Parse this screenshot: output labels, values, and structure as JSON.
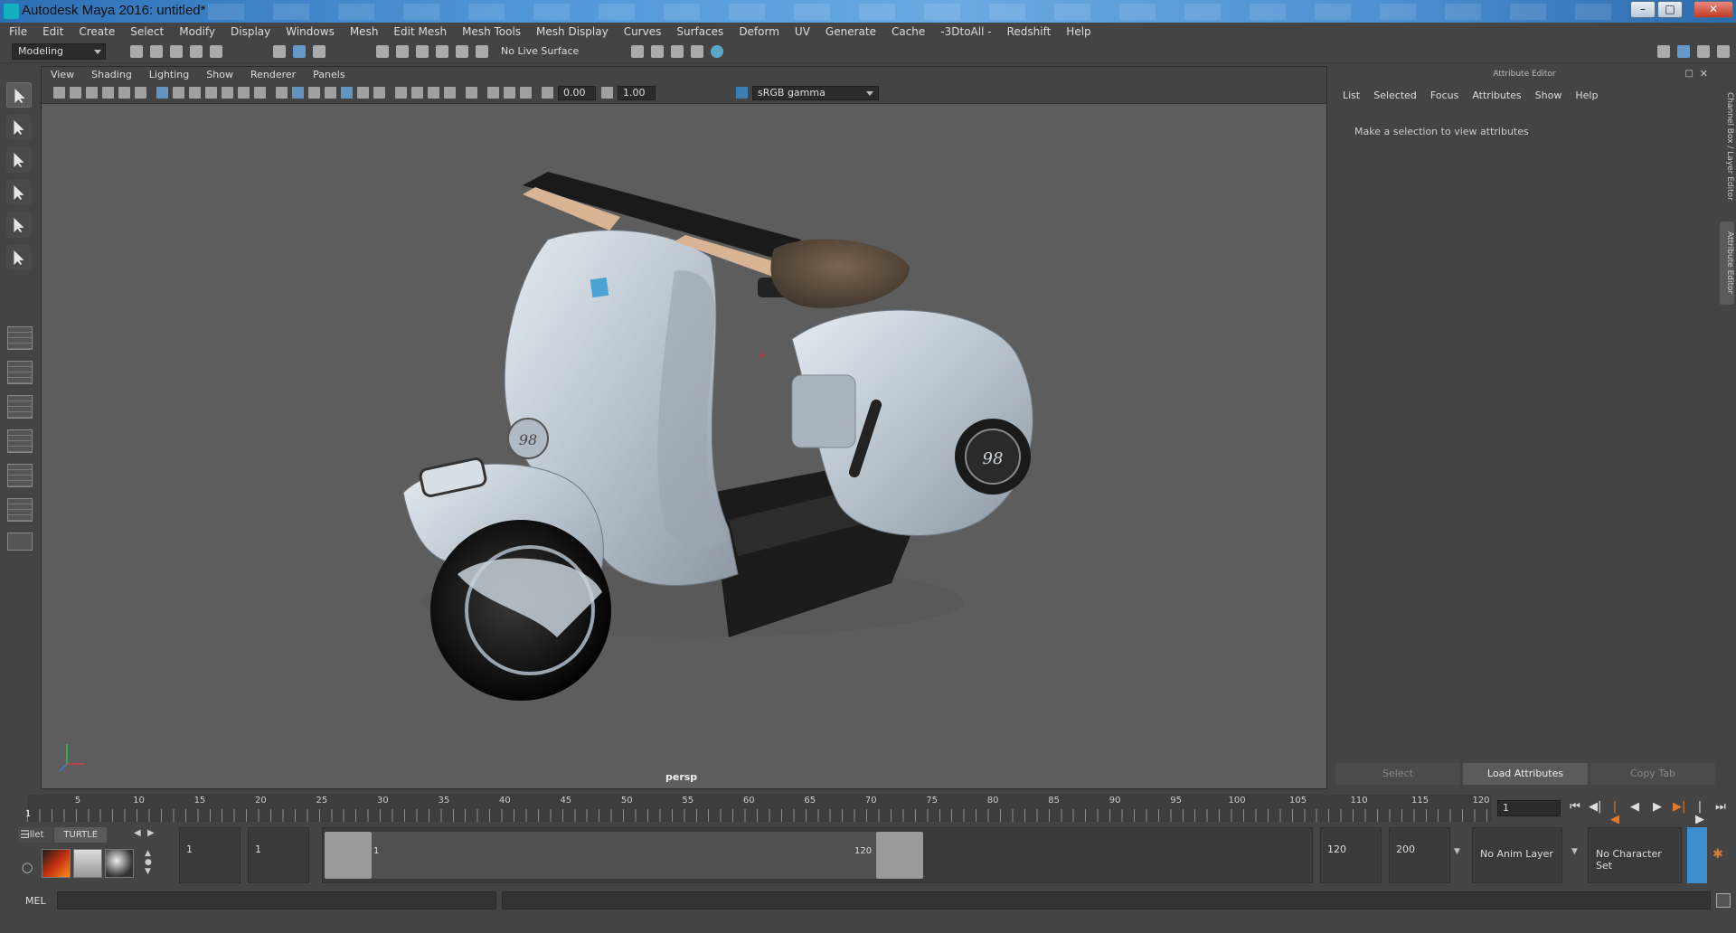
{
  "window": {
    "title": "Autodesk Maya 2016: untitled*"
  },
  "menubar": [
    "File",
    "Edit",
    "Create",
    "Select",
    "Modify",
    "Display",
    "Windows",
    "Mesh",
    "Edit Mesh",
    "Mesh Tools",
    "Mesh Display",
    "Curves",
    "Surfaces",
    "Deform",
    "UV",
    "Generate",
    "Cache",
    "-3DtoAll -",
    "Redshift",
    "Help"
  ],
  "status_toolbar": {
    "mode": "Modeling",
    "live_surface": "No Live Surface"
  },
  "viewport": {
    "menu": [
      "View",
      "Shading",
      "Lighting",
      "Show",
      "Renderer",
      "Panels"
    ],
    "near_clip": "0.00",
    "exposure": "1.00",
    "color_space": "sRGB gamma",
    "camera_label": "persp",
    "decal_left": "98",
    "decal_right": "98"
  },
  "attribute_editor": {
    "header": "Attribute Editor",
    "menu": [
      "List",
      "Selected",
      "Focus",
      "Attributes",
      "Show",
      "Help"
    ],
    "message": "Make a selection to view attributes",
    "buttons": {
      "select": "Select",
      "load": "Load Attributes",
      "copy_tab": "Copy Tab"
    },
    "side_tabs": {
      "channel_box": "Channel Box / Layer Editor",
      "attribute_editor": "Attribute Editor"
    }
  },
  "timeline": {
    "start_label": "1",
    "ticks": [
      "5",
      "10",
      "15",
      "20",
      "25",
      "30",
      "35",
      "40",
      "45",
      "50",
      "55",
      "60",
      "65",
      "70",
      "75",
      "80",
      "85",
      "90",
      "95",
      "100",
      "105",
      "110",
      "115",
      "120"
    ],
    "current_frame": "1"
  },
  "range": {
    "shelf_tabs": [
      "illet",
      "TURTLE"
    ],
    "start_time": "1",
    "playback_start": "1",
    "slider_start": "1",
    "slider_end": "120",
    "playback_end": "120",
    "end_time": "200",
    "anim_layer": "No Anim Layer",
    "character_set": "No Character Set"
  },
  "command_line": {
    "label": "MEL"
  },
  "colors": {
    "accent": "#3c8ed0",
    "maya_teal": "#19c7d6",
    "scooter_body": "#c9d3dc",
    "viewport_bg": "#5d5d5d"
  }
}
